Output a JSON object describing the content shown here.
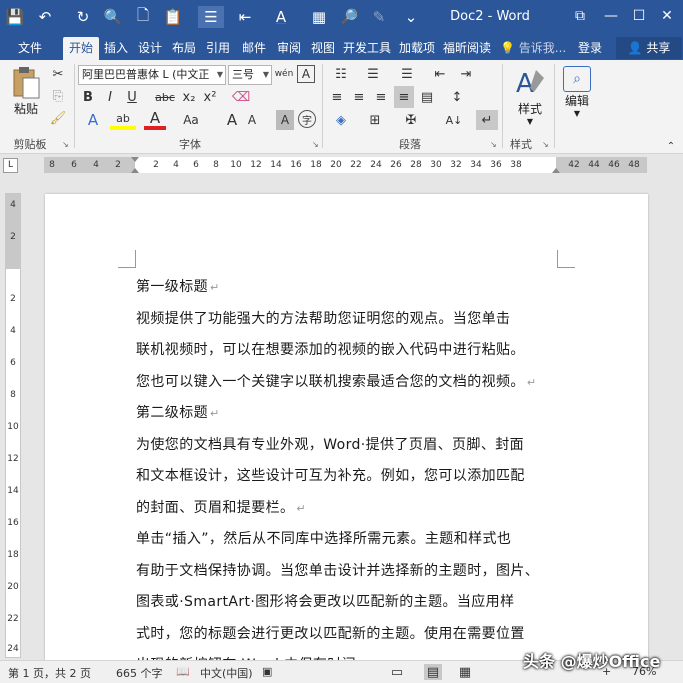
{
  "window": {
    "title": "Doc2 - Word",
    "controls": {
      "restore": "⧉",
      "minimize": "—",
      "maximize": "☐",
      "close": "✕"
    }
  },
  "quick_access": {
    "save": "💾",
    "undo": "↶",
    "repeat": "↻",
    "print_preview": "🔍",
    "new": "🗋",
    "paste": "📋",
    "list": "☰",
    "format": "⇤",
    "font_color": "A",
    "table": "▦",
    "find": "🔎",
    "draw": "✎",
    "more": "⌄"
  },
  "tabs": [
    {
      "label": "文件"
    },
    {
      "label": "开始"
    },
    {
      "label": "插入"
    },
    {
      "label": "设计"
    },
    {
      "label": "布局"
    },
    {
      "label": "引用"
    },
    {
      "label": "邮件"
    },
    {
      "label": "审阅"
    },
    {
      "label": "视图"
    },
    {
      "label": "开发工具"
    },
    {
      "label": "加载项"
    },
    {
      "label": "福昕阅读"
    }
  ],
  "tell_me": "告诉我...",
  "sign_in": "登录",
  "share": "共享",
  "ribbon": {
    "clipboard": {
      "label": "剪贴板",
      "paste": "粘贴"
    },
    "font": {
      "label": "字体",
      "font_name": "阿里巴巴普惠体 L (中文正",
      "font_size": "三号",
      "wen": "wén",
      "A_box": "A",
      "bold": "B",
      "italic": "I",
      "underline": "U",
      "strike": "abc",
      "sub": "x₂",
      "sup": "x²",
      "effects": "A",
      "highlight": "ab",
      "color": "A",
      "case": "Aa",
      "grow": "A",
      "shrink": "A",
      "shade": "A",
      "circle": "字"
    },
    "paragraph": {
      "label": "段落"
    },
    "styles": {
      "label": "样式",
      "button": "样式"
    },
    "editing": {
      "button": "编辑"
    }
  },
  "ruler": {
    "box": "L",
    "ticks": [
      "8",
      "6",
      "4",
      "2",
      "2",
      "4",
      "6",
      "8",
      "10",
      "12",
      "14",
      "16",
      "18",
      "20",
      "22",
      "24",
      "26",
      "28",
      "30",
      "32",
      "34",
      "36",
      "38",
      "42",
      "44",
      "46",
      "48"
    ],
    "vticks": [
      "4",
      "2",
      "2",
      "4",
      "6",
      "8",
      "10",
      "12",
      "14",
      "16",
      "18",
      "20",
      "22",
      "24"
    ]
  },
  "document": {
    "lines": [
      "第一级标题",
      "视频提供了功能强大的方法帮助您证明您的观点。当您单击",
      "联机视频时，可以在想要添加的视频的嵌入代码中进行粘贴。",
      "您也可以键入一个关键字以联机搜索最适合您的文档的视频。",
      "第二级标题",
      "为使您的文档具有专业外观，Word·提供了页眉、页脚、封面",
      "和文本框设计，这些设计可互为补充。例如，您可以添加匹配",
      "的封面、页眉和提要栏。",
      "单击“插入”，然后从不同库中选择所需元素。主题和样式也",
      "有助于文档保持协调。当您单击设计并选择新的主题时，图片、",
      "图表或·SmartArt·图形将会更改以匹配新的主题。当应用样",
      "式时，您的标题会进行更改以匹配新的主题。使用在需要位置",
      "出现的新按钮在·Word·中保存时间。"
    ],
    "para_mark": "↵"
  },
  "status": {
    "page": "第 1 页，共 2 页",
    "words": "665 个字",
    "proof": "📖",
    "lang": "中文(中国)",
    "macro": "▣",
    "zoom": "76%",
    "zoom_plus": "+"
  },
  "watermark": "头条 @爆炒Office"
}
